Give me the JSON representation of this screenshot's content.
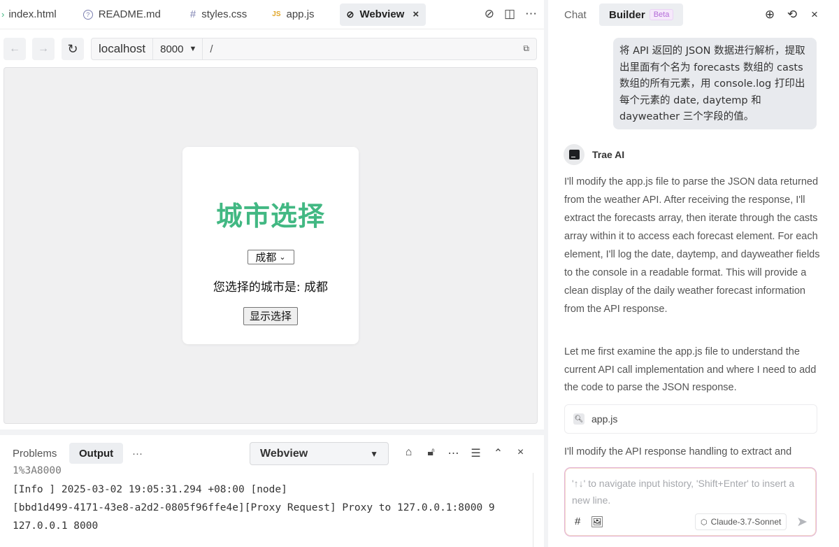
{
  "editor": {
    "tabs": [
      {
        "icon": "›",
        "label": "index.html"
      },
      {
        "icon": "?",
        "label": "README.md"
      },
      {
        "icon": "#",
        "label": "styles.css"
      },
      {
        "icon": "JS",
        "label": "app.js"
      },
      {
        "icon": "⊘",
        "label": "Webview"
      }
    ],
    "active_tab_close": "×"
  },
  "browser": {
    "host": "localhost",
    "port": "8000",
    "path": "/"
  },
  "app_page": {
    "title": "城市选择",
    "selected_city": "成都",
    "result_text": "您选择的城市是: 成都",
    "show_button": "显示选择"
  },
  "bottom_panel": {
    "tabs": {
      "problems": "Problems",
      "output": "Output",
      "more": "···"
    },
    "source": "Webview",
    "output_lines": [
      "1%3A8000",
      "[Info ] 2025-03-02 19:05:31.294 +08:00 [node]",
      "[bbd1d499-4171-43e8-a2d2-0805f96ffe4e][Proxy Request] Proxy to 127.0.0.1:8000 9",
      "127.0.0.1 8000"
    ]
  },
  "chat": {
    "tabs": {
      "chat": "Chat",
      "builder": "Builder",
      "beta": "Beta"
    },
    "user_message": "将 API 返回的 JSON 数据进行解析，提取出里面有个名为 forecasts 数组的 casts 数组的所有元素，用 console.log 打印出每个元素的 date, daytemp 和 dayweather 三个字段的值。",
    "ai_name": "Trae AI",
    "ai_paragraph_1": "I'll modify the app.js file to parse the JSON data returned from the weather API. After receiving the response, I'll extract the forecasts array, then iterate through the casts array within it to access each forecast element. For each element, I'll log the date, daytemp, and dayweather fields to the console in a readable format. This will provide a clean display of the daily weather forecast information from the API response.",
    "ai_paragraph_2": "Let me first examine the app.js file to understand the current API call implementation and where I need to add the code to parse the JSON response.",
    "file_ref": "app.js",
    "ai_paragraph_3": "I'll modify the API response handling to extract and",
    "input_placeholder": "'↑↓' to navigate input history, 'Shift+Enter' to insert a new line.",
    "model": "Claude-3.7-Sonnet"
  },
  "colors": {
    "accent_green": "#42b883",
    "beta_purple": "#b46bd8"
  }
}
